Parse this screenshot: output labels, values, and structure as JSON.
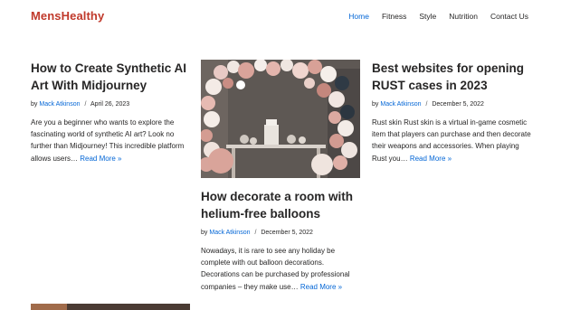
{
  "site": {
    "logo": "MensHealthy"
  },
  "nav": {
    "items": [
      {
        "label": "Home"
      },
      {
        "label": "Fitness"
      },
      {
        "label": "Style"
      },
      {
        "label": "Nutrition"
      },
      {
        "label": "Contact Us"
      }
    ]
  },
  "posts": [
    {
      "title": "How to Create Synthetic AI Art With Midjourney",
      "by": "by",
      "author": "Mack Atkinson",
      "sep": "/",
      "date": "April 26, 2023",
      "excerpt": "Are you a beginner who wants to explore the fascinating world of synthetic AI art? Look no further than Midjourney! This incredible platform allows users…",
      "more": "Read More »"
    },
    {
      "title": "How decorate a room with helium-free balloons",
      "by": "by",
      "author": "Mack Atkinson",
      "sep": "/",
      "date": "December 5, 2022",
      "excerpt": "Nowadays, it is rare to see any holiday be complete with out balloon decorations. Decorations can be purchased by professional companies – they make use…",
      "more": "Read More »",
      "image_icon": "balloon-arch-photo"
    },
    {
      "title": "Best websites for opening RUST cases in 2023",
      "by": "by",
      "author": "Mack Atkinson",
      "sep": "/",
      "date": "December 5, 2022",
      "excerpt": "Rust skin Rust skin is a virtual in-game cosmetic item that players can purchase and then decorate their weapons and accessories. When playing Rust you…",
      "more": "Read More »"
    }
  ],
  "colors": {
    "brand": "#c0392b",
    "link": "#0366d6",
    "text": "#272626"
  }
}
